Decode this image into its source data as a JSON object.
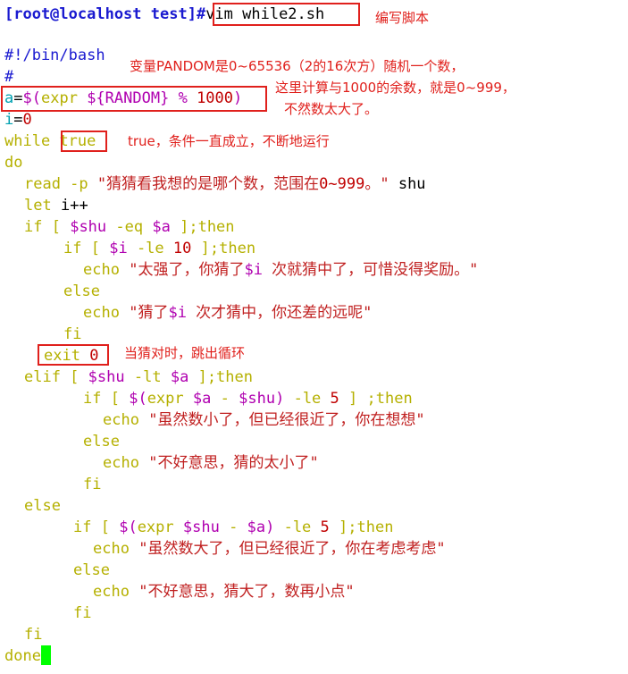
{
  "prompt": {
    "text": "[root@localhost test]",
    "symbol": "#",
    "command": "vim while2.sh"
  },
  "annotations": {
    "edit_script": "编写脚本",
    "random_line1": "变量PANDOM是0~65536（2的16次方）随机一个数，",
    "random_line2": "这里计算与1000的余数，就是0~999，",
    "random_line3": "不然数太大了。",
    "while_true": "true，条件一直成立，不断地运行",
    "exit_note": "当猜对时，跳出循环"
  },
  "script": {
    "shebang": "#!/bin/bash",
    "comment": "#",
    "assign_a": {
      "var": "a",
      "eq": "=",
      "open": "$(",
      "expr": "expr",
      "random": "${RANDOM}",
      "mod": "%",
      "num": "1000",
      "close": ")"
    },
    "assign_i": {
      "var": "i",
      "eq": "=",
      "num": "0"
    },
    "while": {
      "kw": "while",
      "cond": "true"
    },
    "do": "do",
    "read": {
      "kw": "read -p",
      "q1": "\"猜猜看我想的是哪个数，范围在",
      "range": "0~999",
      "q2": "。\"",
      "var": "shu"
    },
    "let": {
      "kw": "let",
      "expr": "i++"
    },
    "if1": {
      "kw": "if [",
      "v1": "$shu",
      "op": "-eq",
      "v2": "$a",
      "end": "];then"
    },
    "if2": {
      "kw": "if [",
      "v1": "$i",
      "op": "-le",
      "num": "10",
      "end": "];then"
    },
    "echo1": {
      "kw": "echo",
      "s1": "\"太强了，你猜了",
      "v": "$i",
      "s2": " 次就猜中了，可惜没得奖励。\""
    },
    "else1": "else",
    "echo2": {
      "kw": "echo",
      "s1": "\"猜了",
      "v": "$i",
      "s2": " 次才猜中，你还差的远呢\""
    },
    "fi1": "fi",
    "exit": {
      "kw": "exit",
      "num": "0"
    },
    "elif": {
      "kw": "elif [",
      "v1": "$shu",
      "op": "-lt",
      "v2": "$a",
      "end": "];then"
    },
    "if3": {
      "kw": "if [",
      "sub": "$(",
      "expr": "expr",
      "v1": "$a",
      "minus": "-",
      "v2": "$shu",
      "close": ")",
      "op": "-le",
      "num": "5",
      "end": "] ;then"
    },
    "echo3": {
      "kw": "echo",
      "s": "\"虽然数小了，但已经很近了，你在想想\""
    },
    "else2": "else",
    "echo4": {
      "kw": "echo",
      "s": "\"不好意思，猜的太小了\""
    },
    "fi2": "fi",
    "else3": "else",
    "if4": {
      "kw": "if [",
      "sub": "$(",
      "expr": "expr",
      "v1": "$shu",
      "minus": "-",
      "v2": "$a",
      "close": ")",
      "op": "-le",
      "num": "5",
      "end": "];then"
    },
    "echo5": {
      "kw": "echo",
      "s": "\"虽然数大了，但已经很近了，你在考虑考虑\""
    },
    "else4": "else",
    "echo6": {
      "kw": "echo",
      "s": "\"不好意思，猜大了，数再小点\""
    },
    "fi3": "fi",
    "fi4": "fi",
    "done": "done"
  }
}
